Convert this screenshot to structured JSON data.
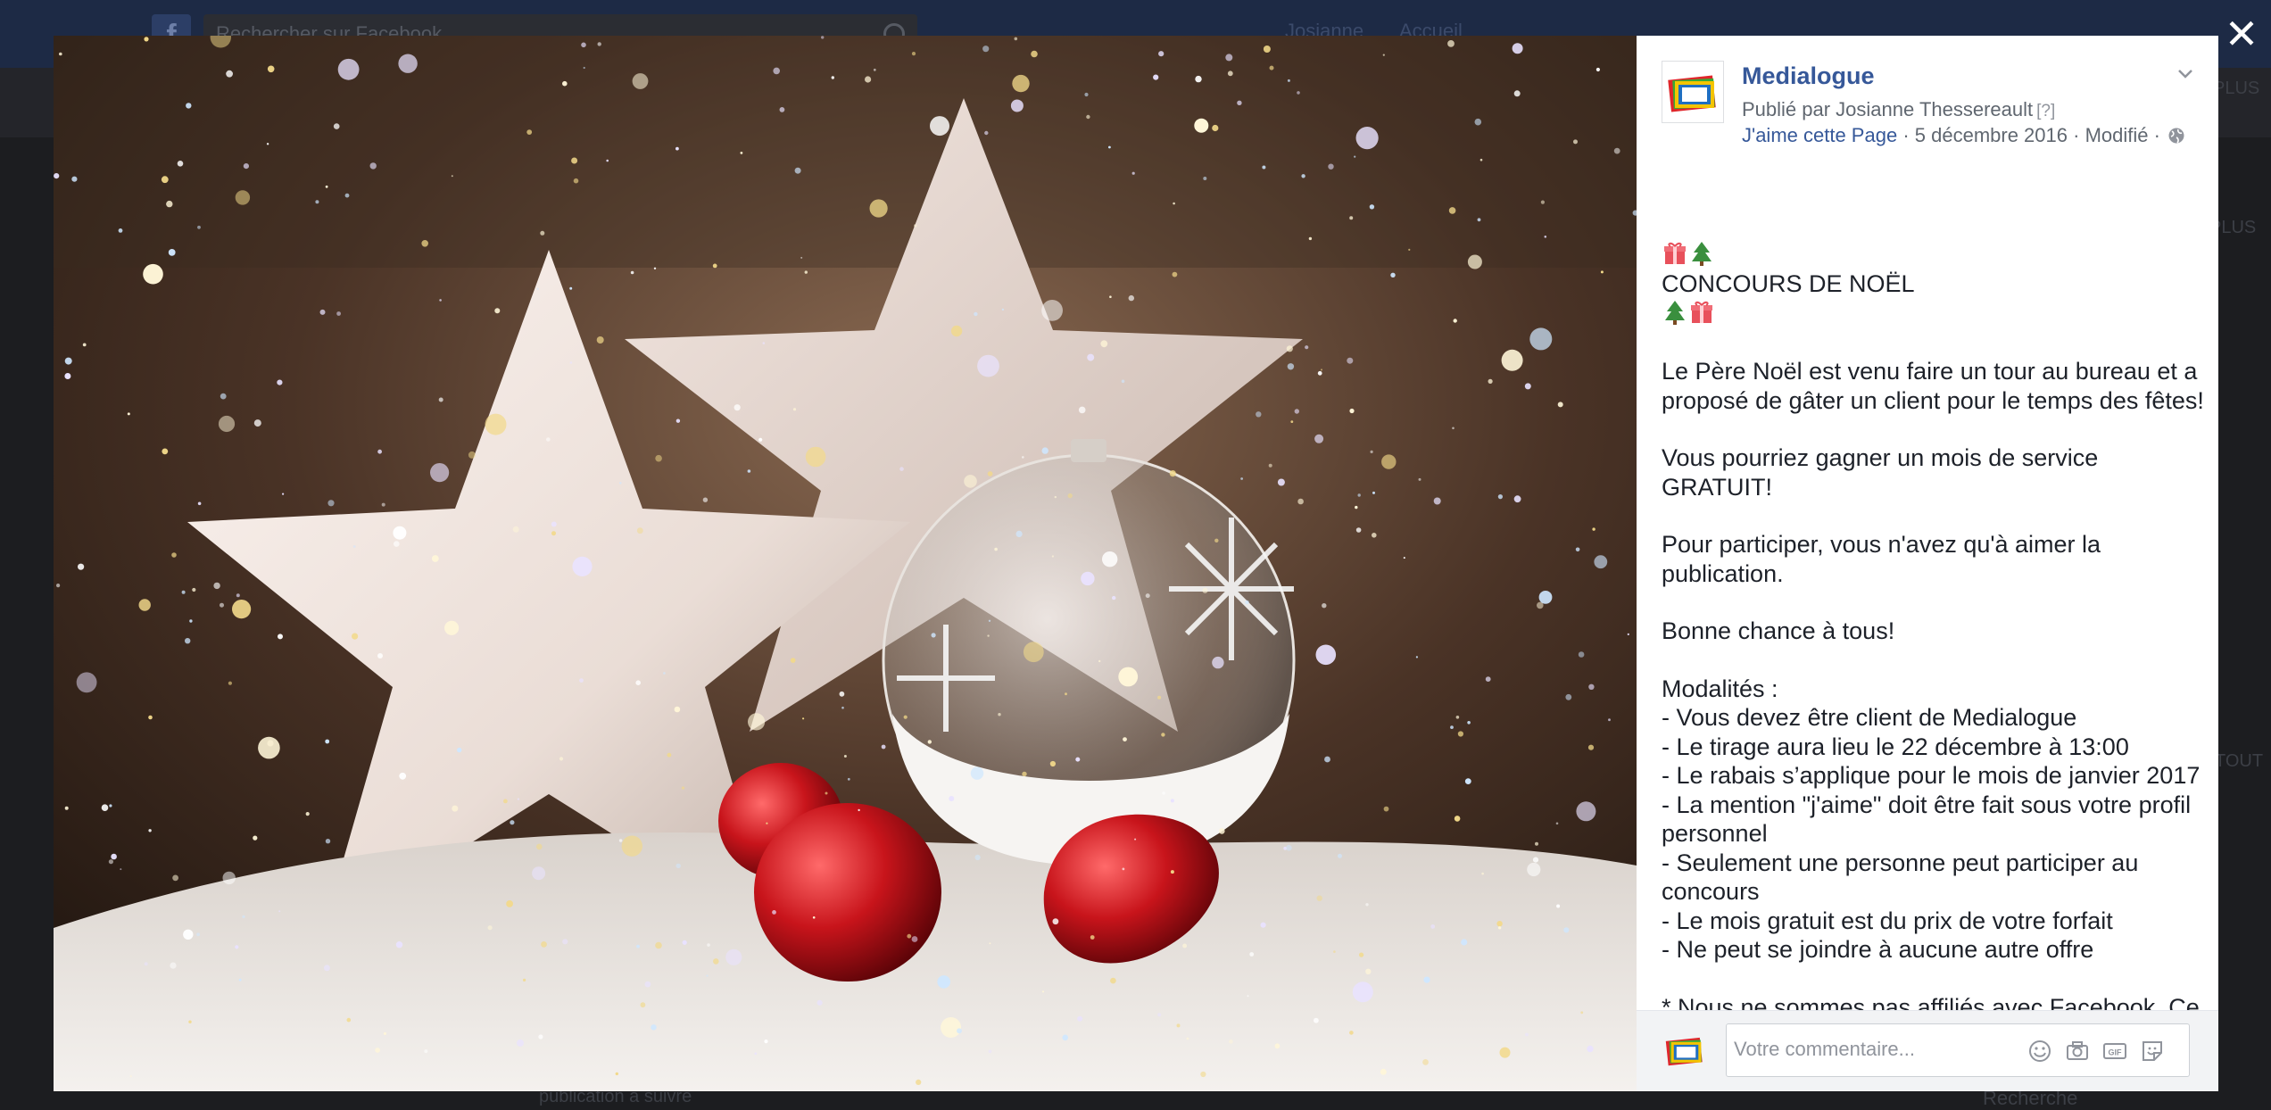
{
  "background": {
    "search_placeholder": "Rechercher sur Facebook",
    "user_name": "Josianne",
    "home_label": "Accueil",
    "plus_label": "PLUS",
    "tout_label": "TOUT",
    "recherche_label": "Recherche",
    "bottom_text": "publication a suivre"
  },
  "photo": {
    "description_icon": "christmas-stars-photo"
  },
  "post": {
    "page_name": "Medialogue",
    "published_by": "Publié par Josianne Thessereault",
    "help_marker": "[?]",
    "like_page": "J'aime cette Page",
    "date": "5 décembre 2016",
    "modified": "Modifié",
    "separator": "·",
    "title": "CONCOURS DE NOËL",
    "paragraphs": [
      "Le Père Noël est venu faire un tour au bureau et a proposé de gâter un client pour le temps des fêtes!",
      "Vous pourriez gagner un mois de service GRATUIT!",
      "Pour participer, vous n'avez qu'à aimer la publication.",
      "Bonne chance à tous!",
      "Modalités :\n- Vous devez être client de Medialogue\n- Le tirage aura lieu le 22 décembre à 13:00\n- Le rabais s’applique pour le mois de janvier 2017\n- La mention \"j'aime\" doit être fait sous votre profil personnel\n- Seulement une personne peut participer au concours\n- Le mois gratuit est du prix de votre forfait\n- Ne peut se joindre à aucune autre offre",
      "* Nous ne sommes pas affiliés avec Facebook. Ce concours n'est pas géré, commandité ou approuvé par Facebook."
    ]
  },
  "comment": {
    "placeholder": "Votre commentaire..."
  },
  "colors": {
    "link_blue": "#365899",
    "logo_red": "#e0262b",
    "logo_green": "#3aa935",
    "logo_yellow": "#f4c400",
    "logo_blue": "#1f6fc1"
  }
}
